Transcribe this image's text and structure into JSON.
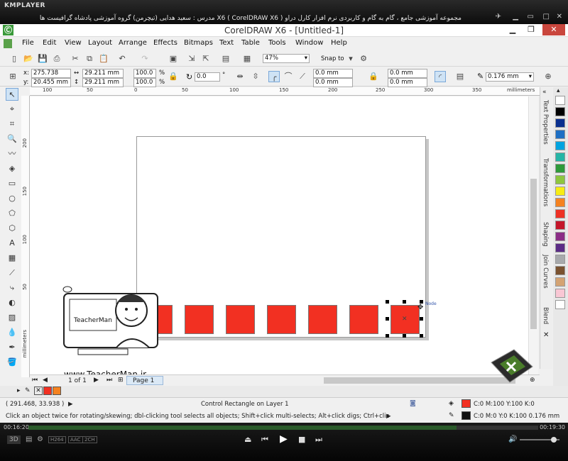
{
  "kmplayer": {
    "logo": "KMPLAYER",
    "title": "مجموعه آموزشی جامع ، گام به گام و کاربردی نرم افزار کارل دراو X6 ( CorelDRAW X6 ) مدرس : سعید هدایی (تیچرمن) گروه آموزشی پادشاه گرافیست ها"
  },
  "app": {
    "title": "CorelDRAW X6 - [Untitled-1]"
  },
  "menu": [
    "File",
    "Edit",
    "View",
    "Layout",
    "Arrange",
    "Effects",
    "Bitmaps",
    "Text",
    "Table",
    "Tools",
    "Window",
    "Help"
  ],
  "toolbar": {
    "zoom": "47%",
    "snap": "Snap to"
  },
  "props": {
    "x_label": "x:",
    "x": "275.738 mm",
    "y_label": "y:",
    "y": "20.455 mm",
    "w": "29.211 mm",
    "h": "29.211 mm",
    "sx": "100.0",
    "sy": "100.0",
    "pct": "%",
    "angle": "0.0",
    "deg": "°",
    "c1": "0.0 mm",
    "c2": "0.0 mm",
    "c3": "0.0 mm",
    "c4": "0.0 mm",
    "outline": "0.176 mm"
  },
  "ruler_h": [
    "100",
    "50",
    "0",
    "50",
    "100",
    "150",
    "200",
    "250",
    "300",
    "350"
  ],
  "ruler_h_unit": "millimeters",
  "ruler_v": [
    "200",
    "150",
    "100",
    "50"
  ],
  "ruler_v_unit": "millimeters",
  "canvas": {
    "node_hint": "Node",
    "link_text": "www.TeacherMan.ir",
    "logo_text": "TeacherMan"
  },
  "dockers": [
    "Text Properties",
    "Transformations",
    "Shaping",
    "Join Curves",
    "Blend"
  ],
  "page_nav": {
    "count": "1 of 1",
    "tab": "Page 1"
  },
  "palette": [
    "#ffffff",
    "#000000",
    "#0a2f8f",
    "#1e6fc4",
    "#00a3e0",
    "#26b5a6",
    "#2e9a3a",
    "#8dc63f",
    "#f7ec13",
    "#f58220",
    "#ee3124",
    "#c4162a",
    "#8b2d86",
    "#5b2c86",
    "#a7a9ac",
    "#7a5230",
    "#d4a373",
    "#f9c7d4",
    "#ffffff"
  ],
  "status": {
    "coords": "( 291.468, 33.938 )",
    "object": "Control Rectangle on Layer 1",
    "fill": "C:0 M:100 Y:100 K:0",
    "outline": "C:0 M:0 Y:0 K:100  0.176 mm",
    "hint": "Click an object twice for rotating/skewing; dbl-clicking tool selects all objects; Shift+click multi-selects; Alt+click digs; Ctrl+click selects in a group"
  },
  "player": {
    "elapsed": "00:16:20",
    "total": "00:19:30",
    "badges": [
      "3D",
      "H264",
      "AAC",
      "2CH"
    ],
    "progress": 0.84
  },
  "colors": {
    "rect_fill": "#f23022",
    "doc_fill": "#f23022",
    "doc_fill2": "#f58220"
  }
}
